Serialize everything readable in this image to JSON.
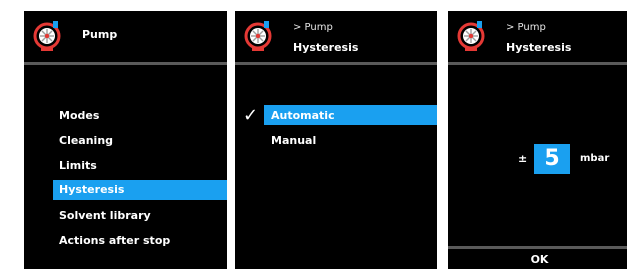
{
  "colors": {
    "panel_background": "#000000",
    "selection": "#1aa0f0",
    "divider": "#5a5a5a",
    "pump_icon_ring": "#e53935"
  },
  "icons": {
    "pump": "pump-icon",
    "check": "checkmark-icon"
  },
  "screen_pump_menu": {
    "title": "Pump",
    "items": [
      {
        "label": "Modes"
      },
      {
        "label": "Cleaning"
      },
      {
        "label": "Limits"
      },
      {
        "label": "Hysteresis",
        "selected": true
      },
      {
        "label": "Solvent library"
      },
      {
        "label": "Actions after stop"
      }
    ]
  },
  "screen_hysteresis_mode": {
    "breadcrumb": "> Pump",
    "title": "Hysteresis",
    "check_glyph": "✓",
    "options": [
      {
        "label": "Automatic",
        "selected": true,
        "checked": true
      },
      {
        "label": "Manual",
        "selected": false,
        "checked": false
      }
    ]
  },
  "screen_hysteresis_value": {
    "breadcrumb": "> Pump",
    "title": "Hysteresis",
    "sign": "±",
    "value": "5",
    "unit": "mbar",
    "ok_label": "OK"
  }
}
